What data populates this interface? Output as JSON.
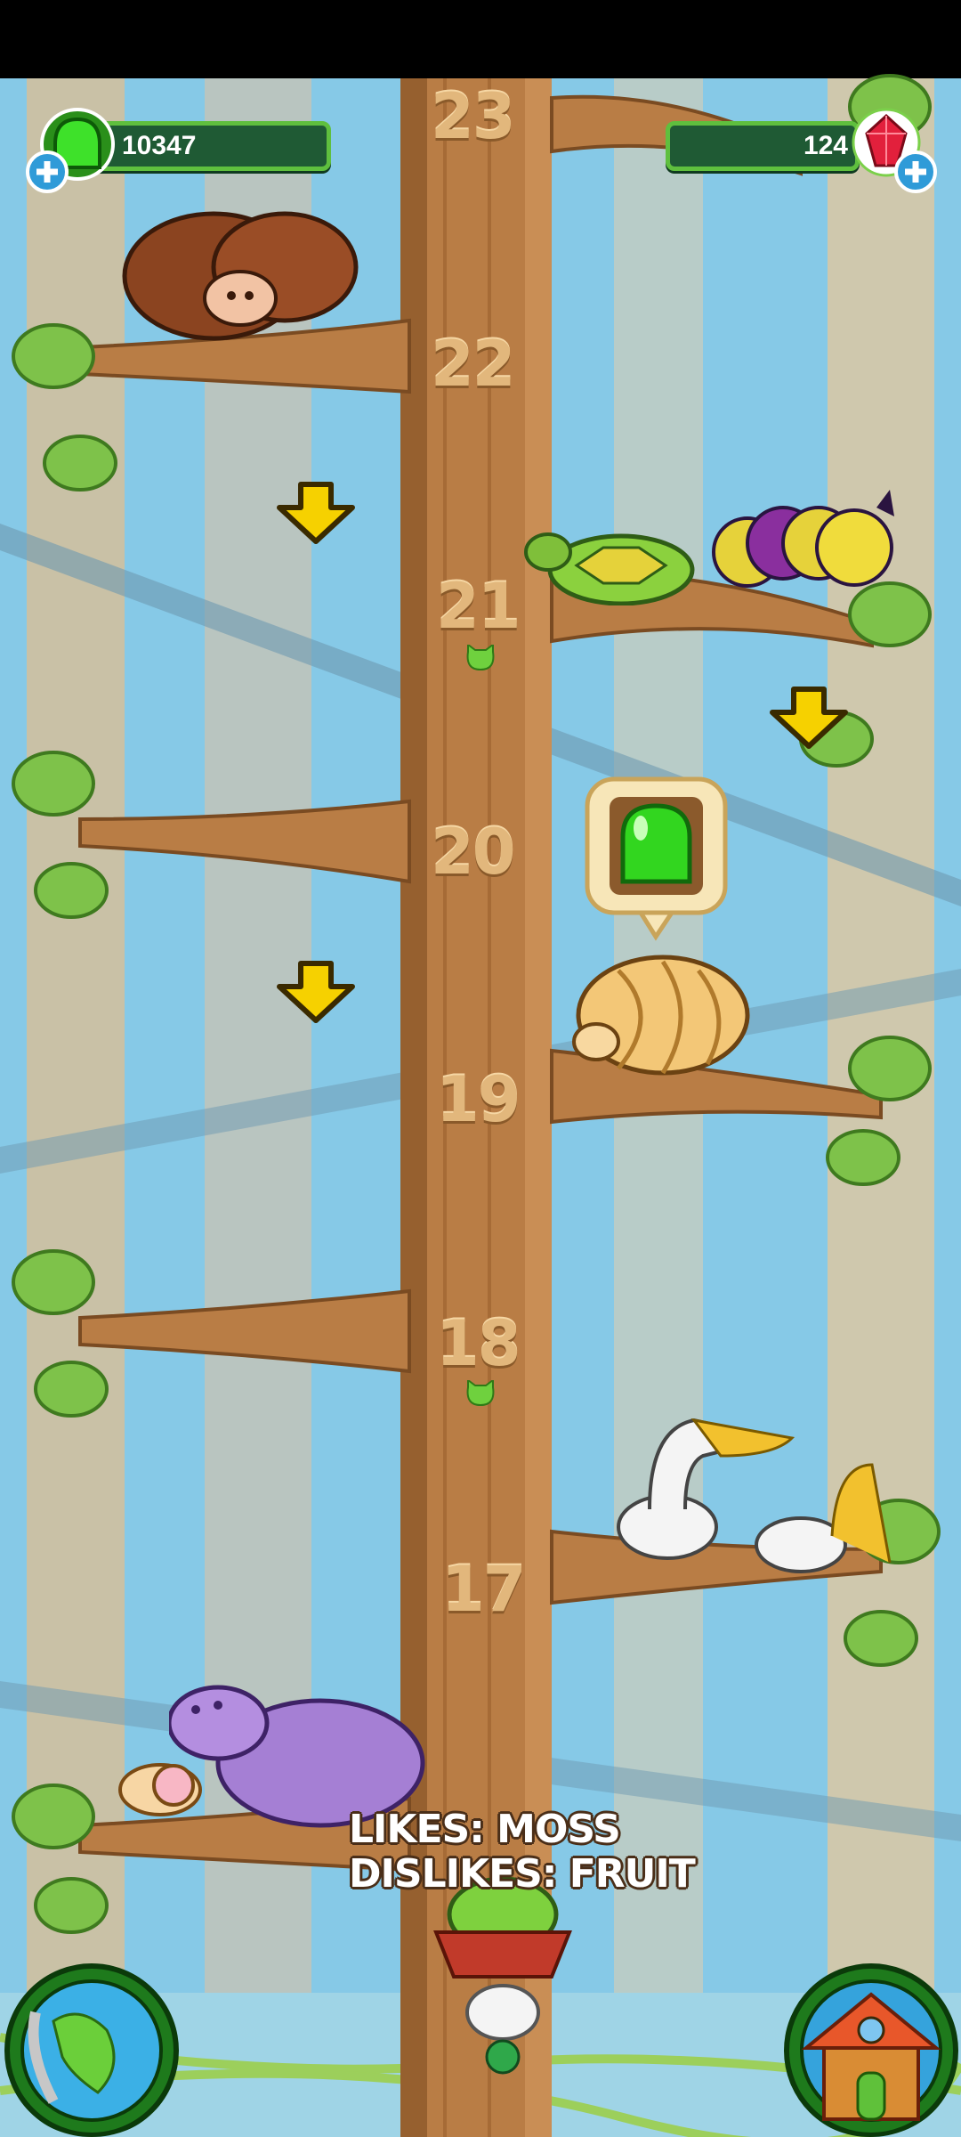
{
  "hud": {
    "gum_count": "10347",
    "gem_count": "124"
  },
  "tree": {
    "levels": [
      "23",
      "22",
      "21",
      "20",
      "19",
      "18",
      "17"
    ]
  },
  "selected_animal": {
    "likes": "LIKES: MOSS",
    "dislikes": "DISLIKES: FRUIT"
  },
  "colors": {
    "sky": "#7fc6e8",
    "trunk": "#b57a44",
    "leaf": "#7ec24a",
    "hud_green": "#5fbf3e",
    "arrow_yellow": "#f6d100"
  },
  "icons": {
    "gum": "green-gum-icon",
    "gem": "red-gem-icon",
    "globe": "globe-icon",
    "house": "house-icon",
    "arrow": "down-arrow-icon"
  }
}
